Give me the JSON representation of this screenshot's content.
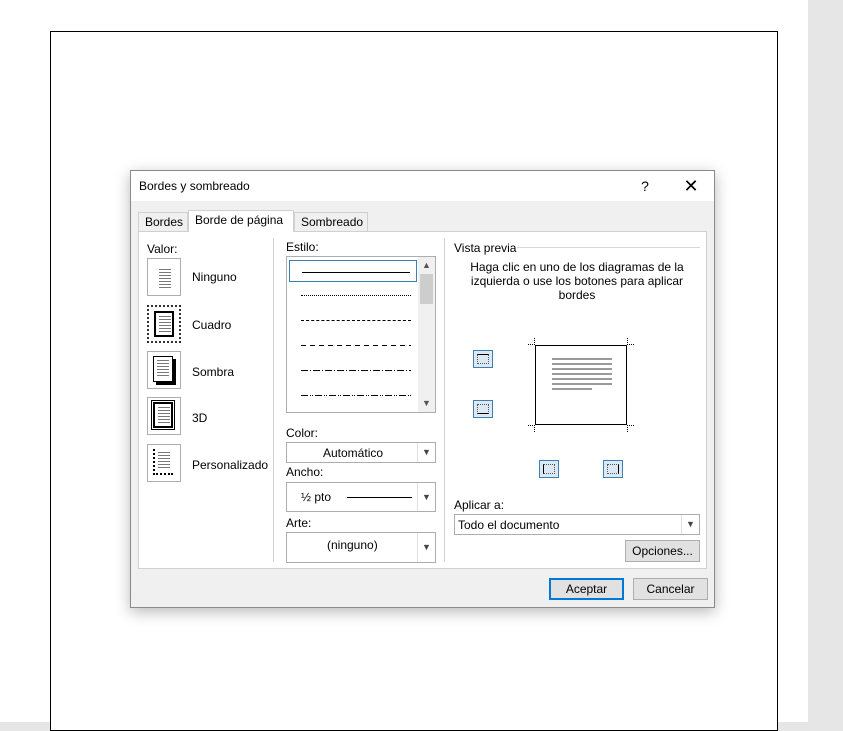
{
  "dialog": {
    "title": "Bordes y sombreado",
    "help_label": "?",
    "close_label": "✕"
  },
  "tabs": [
    {
      "label": "Bordes"
    },
    {
      "label": "Borde de página"
    },
    {
      "label": "Sombreado"
    }
  ],
  "setting": {
    "label": "Valor:",
    "options": [
      {
        "label": "Ninguno"
      },
      {
        "label": "Cuadro"
      },
      {
        "label": "Sombra"
      },
      {
        "label": "3D"
      },
      {
        "label": "Personalizado"
      }
    ],
    "selected": "Cuadro"
  },
  "style": {
    "label": "Estilo:"
  },
  "color": {
    "label": "Color:",
    "value": "Automático"
  },
  "width": {
    "label": "Ancho:",
    "value": "½ pto"
  },
  "art": {
    "label": "Arte:",
    "value": "(ninguno)"
  },
  "preview": {
    "label": "Vista previa",
    "help": "Haga clic en uno de los diagramas de la izquierda o use los botones para aplicar bordes"
  },
  "apply_to": {
    "label": "Aplicar a:",
    "value": "Todo el documento"
  },
  "buttons": {
    "options": "Opciones...",
    "ok": "Aceptar",
    "cancel": "Cancelar"
  },
  "colors": {
    "accent": "#0078d7",
    "selection_border": "#3c7fb1"
  }
}
